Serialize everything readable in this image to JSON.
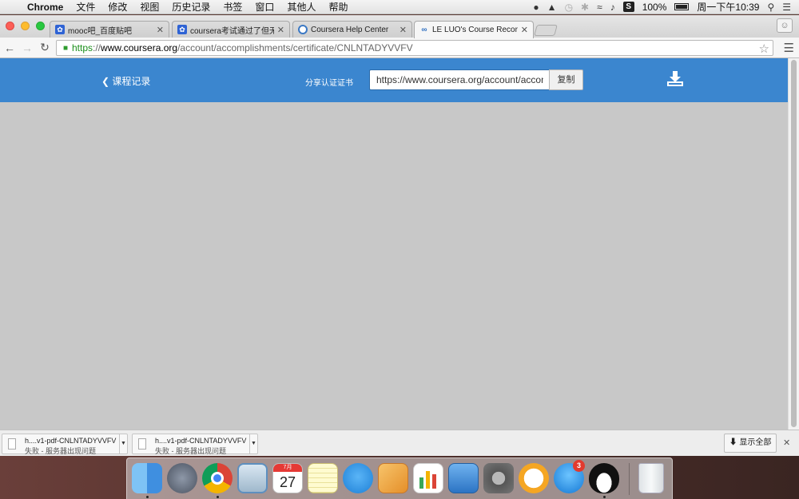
{
  "menubar": {
    "app": "Chrome",
    "items": [
      "文件",
      "修改",
      "视图",
      "历史记录",
      "书签",
      "窗口",
      "其他人",
      "帮助"
    ],
    "battery": "100%",
    "clock": "周一下午10:39"
  },
  "tabs": [
    {
      "title": "mooc吧_百度贴吧",
      "icon": "baidu-paw-icon",
      "active": false
    },
    {
      "title": "coursera考试通过了但无法下...",
      "icon": "baidu-paw-icon",
      "active": false
    },
    {
      "title": "Coursera Help Center",
      "icon": "help-center-icon",
      "active": false
    },
    {
      "title": "LE LUO's Course Record on...",
      "icon": "coursera-icon",
      "active": true
    }
  ],
  "omnibox": {
    "scheme": "https",
    "sep": "://",
    "host": "www.coursera.org",
    "path": "/account/accomplishments/certificate/CNLNTADYVVFV"
  },
  "page": {
    "back_label": "课程记录",
    "share_label": "分享认证证书",
    "share_url": "https://www.coursera.org/account/accomplishments/certificate/CNLNTADYVVFV",
    "copy_label": "复制",
    "bar_color": "#3b86cf",
    "body_color": "#c8c8c8"
  },
  "downloads": [
    {
      "name": "h....v1-pdf-CNLNTADYVVFV",
      "status": "失败 - 服务器出现问题"
    },
    {
      "name": "h....v1-pdf-CNLNTADYVVFV",
      "status": "失败 - 服务器出现问题"
    }
  ],
  "download_shelf": {
    "show_all": "显示全部"
  },
  "dock": {
    "calendar_month": "7月",
    "calendar_day": "27",
    "appstore_badge": "3",
    "apps": [
      "finder-icon",
      "launchpad-icon",
      "chrome-icon",
      "mail-icon",
      "calendar-icon",
      "notes-icon",
      "messages-icon",
      "pages-icon",
      "numbers-icon",
      "keynote-icon",
      "system-preferences-icon",
      "infuse-icon",
      "app-store-icon",
      "qq-icon",
      "trash-icon"
    ]
  }
}
